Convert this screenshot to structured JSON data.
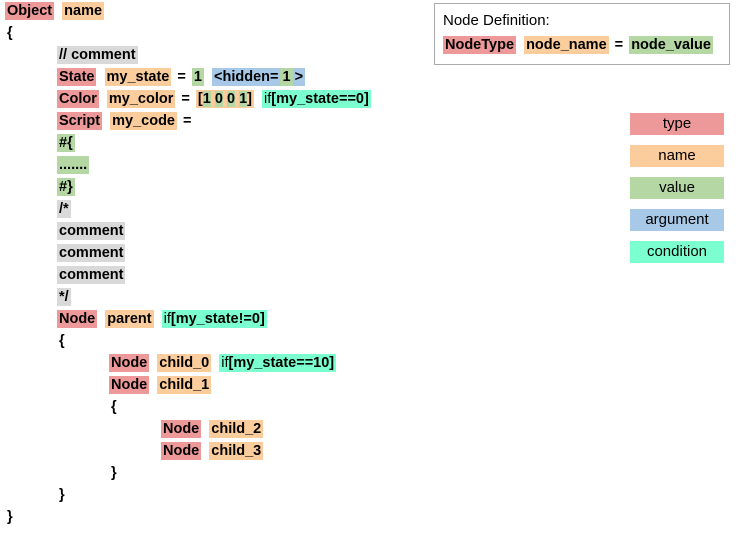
{
  "colors": {
    "type": "#ee9999",
    "name": "#fbcc9c",
    "value": "#b4d7a4",
    "argument": "#a8c8e8",
    "condition": "#7bffd0",
    "comment": "#d9d9d9",
    "background": "#ffffff",
    "text": "#000000",
    "panel_border": "#aaaaaa"
  },
  "code": {
    "lines": [
      {
        "indent": 0,
        "tokens": [
          {
            "text": "Object",
            "kind": "type"
          },
          {
            "text": " ",
            "kind": "plain"
          },
          {
            "text": "name",
            "kind": "name"
          }
        ]
      },
      {
        "indent": 0,
        "tokens": [
          {
            "text": "{",
            "kind": "plain"
          }
        ]
      },
      {
        "indent": 1,
        "tokens": [
          {
            "text": "// comment",
            "kind": "comment"
          }
        ]
      },
      {
        "indent": 1,
        "tokens": [
          {
            "text": "State",
            "kind": "type"
          },
          {
            "text": " ",
            "kind": "plain"
          },
          {
            "text": "my_state",
            "kind": "name"
          },
          {
            "text": " = ",
            "kind": "plain"
          },
          {
            "text": "1",
            "kind": "value"
          },
          {
            "text": " ",
            "kind": "plain"
          },
          {
            "text": "<hidden=",
            "kind": "argument"
          },
          {
            "text": "1",
            "kind": "value"
          },
          {
            "text": ">",
            "kind": "argument"
          }
        ]
      },
      {
        "indent": 1,
        "tokens": [
          {
            "text": "Color",
            "kind": "type"
          },
          {
            "text": " ",
            "kind": "plain"
          },
          {
            "text": "my_color",
            "kind": "name"
          },
          {
            "text": " = ",
            "kind": "plain"
          },
          {
            "text": "[1 0 0 1]",
            "kind": "array",
            "digits": [
              "1",
              "0",
              "0",
              "1"
            ]
          },
          {
            "text": " ",
            "kind": "plain"
          },
          {
            "text": "if[my_state==0]",
            "kind": "condition",
            "keyword": "if",
            "body": "[my_state==0]"
          }
        ]
      },
      {
        "indent": 1,
        "tokens": [
          {
            "text": "Script",
            "kind": "type"
          },
          {
            "text": " ",
            "kind": "plain"
          },
          {
            "text": "my_code",
            "kind": "name"
          },
          {
            "text": " =",
            "kind": "plain"
          }
        ]
      },
      {
        "indent": 1,
        "tokens": [
          {
            "text": "#{",
            "kind": "value"
          }
        ]
      },
      {
        "indent": 1,
        "tokens": [
          {
            "text": ".......",
            "kind": "value"
          }
        ]
      },
      {
        "indent": 1,
        "tokens": [
          {
            "text": "#}",
            "kind": "value"
          }
        ]
      },
      {
        "indent": 1,
        "tokens": [
          {
            "text": "/*",
            "kind": "comment"
          }
        ]
      },
      {
        "indent": 1,
        "tokens": [
          {
            "text": "comment",
            "kind": "comment"
          }
        ]
      },
      {
        "indent": 1,
        "tokens": [
          {
            "text": "comment",
            "kind": "comment"
          }
        ]
      },
      {
        "indent": 1,
        "tokens": [
          {
            "text": "comment",
            "kind": "comment"
          }
        ]
      },
      {
        "indent": 1,
        "tokens": [
          {
            "text": "*/",
            "kind": "comment"
          }
        ]
      },
      {
        "indent": 1,
        "tokens": [
          {
            "text": "Node",
            "kind": "type"
          },
          {
            "text": " ",
            "kind": "plain"
          },
          {
            "text": "parent",
            "kind": "name"
          },
          {
            "text": " ",
            "kind": "plain"
          },
          {
            "text": "if[my_state!=0]",
            "kind": "condition",
            "keyword": "if",
            "body": "[my_state!=0]"
          }
        ]
      },
      {
        "indent": 1,
        "tokens": [
          {
            "text": "{",
            "kind": "plain"
          }
        ]
      },
      {
        "indent": 2,
        "tokens": [
          {
            "text": "Node",
            "kind": "type"
          },
          {
            "text": " ",
            "kind": "plain"
          },
          {
            "text": "child_0",
            "kind": "name"
          },
          {
            "text": " ",
            "kind": "plain"
          },
          {
            "text": "if[my_state==10]",
            "kind": "condition",
            "keyword": "if",
            "body": "[my_state==10]"
          }
        ]
      },
      {
        "indent": 2,
        "tokens": [
          {
            "text": "Node",
            "kind": "type"
          },
          {
            "text": " ",
            "kind": "plain"
          },
          {
            "text": "child_1",
            "kind": "name"
          }
        ]
      },
      {
        "indent": 2,
        "tokens": [
          {
            "text": "{",
            "kind": "plain"
          }
        ]
      },
      {
        "indent": 3,
        "tokens": [
          {
            "text": "Node",
            "kind": "type"
          },
          {
            "text": " ",
            "kind": "plain"
          },
          {
            "text": "child_2",
            "kind": "name"
          }
        ]
      },
      {
        "indent": 3,
        "tokens": [
          {
            "text": "Node",
            "kind": "type"
          },
          {
            "text": " ",
            "kind": "plain"
          },
          {
            "text": "child_3",
            "kind": "name"
          }
        ]
      },
      {
        "indent": 2,
        "tokens": [
          {
            "text": "}",
            "kind": "plain"
          }
        ]
      },
      {
        "indent": 1,
        "tokens": [
          {
            "text": "}",
            "kind": "plain"
          }
        ]
      },
      {
        "indent": 0,
        "tokens": [
          {
            "text": "}",
            "kind": "plain"
          }
        ]
      }
    ]
  },
  "node_definition": {
    "title": "Node Definition:",
    "tokens": [
      {
        "text": "NodeType",
        "kind": "type"
      },
      {
        "text": " ",
        "kind": "plain"
      },
      {
        "text": "node_name",
        "kind": "name"
      },
      {
        "text": " = ",
        "kind": "plain"
      },
      {
        "text": "node_value",
        "kind": "value"
      }
    ]
  },
  "legend": {
    "items": [
      {
        "label": "type",
        "kind": "type"
      },
      {
        "label": "name",
        "kind": "name"
      },
      {
        "label": "value",
        "kind": "value"
      },
      {
        "label": "argument",
        "kind": "argument"
      },
      {
        "label": "condition",
        "kind": "condition"
      }
    ]
  }
}
